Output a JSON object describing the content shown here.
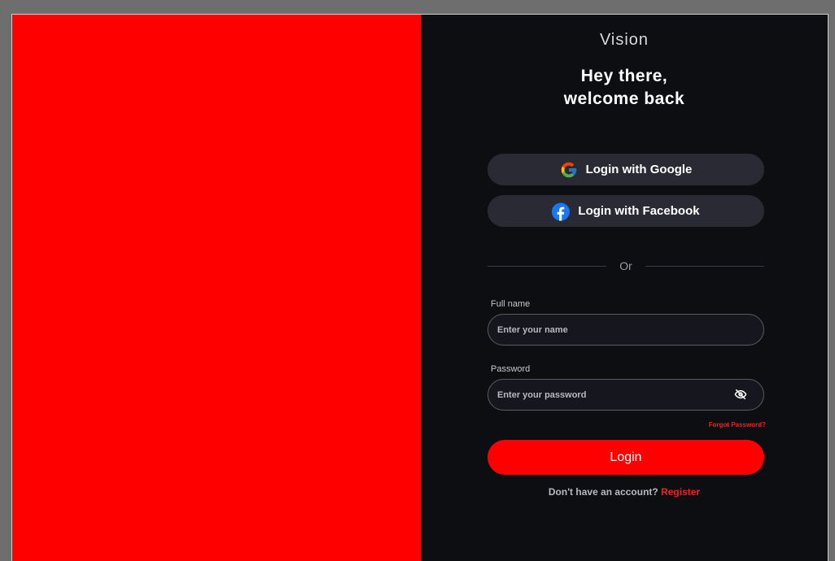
{
  "brand": "Vision",
  "headline": {
    "line1": "Hey there,",
    "line2": "welcome back"
  },
  "social": {
    "google_label": "Login with Google",
    "facebook_label": "Login with Facebook"
  },
  "divider_text": "Or",
  "form": {
    "name_label": "Full name",
    "name_placeholder": "Enter your name",
    "name_value": "",
    "password_label": "Password",
    "password_placeholder": "Enter your password",
    "password_value": "",
    "forgot_label": "Forgot Password?",
    "login_label": "Login"
  },
  "footer": {
    "prompt": "Don't have an account?",
    "register_label": "Register"
  },
  "colors": {
    "accent": "#ff0000",
    "panel_bg": "#0d0e12",
    "button_bg": "#2a2a34",
    "facebook_blue": "#1877f2"
  },
  "icons": {
    "google": "google-icon",
    "facebook": "facebook-icon",
    "password_toggle": "eye-off-icon"
  }
}
